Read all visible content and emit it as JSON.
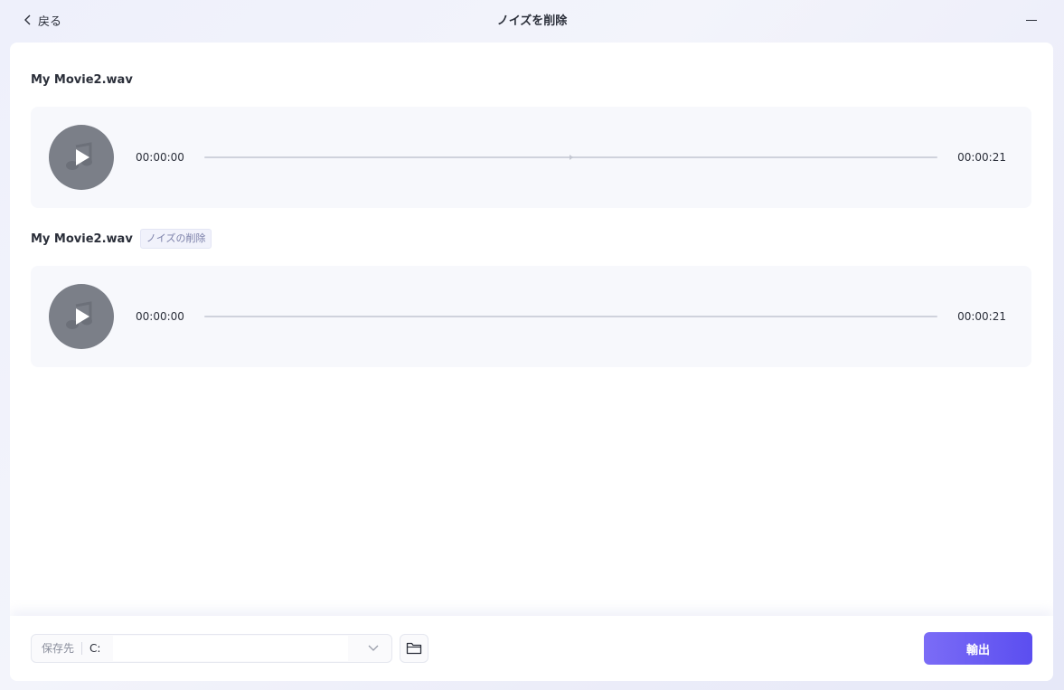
{
  "header": {
    "back_label": "戻る",
    "title": "ノイズを削除"
  },
  "original": {
    "file_name": "My Movie2.wav",
    "time_start": "00:00:00",
    "time_end": "00:00:21",
    "progress": 0
  },
  "processed": {
    "file_name": "My Movie2.wav",
    "tag": "ノイズの削除",
    "time_start": "00:00:00",
    "time_end": "00:00:21",
    "progress": 0
  },
  "footer": {
    "save_label": "保存先",
    "save_path": "C:",
    "export_label": "輸出"
  },
  "colors": {
    "accent": "#6a5cf3",
    "disc": "#7b7f88"
  }
}
